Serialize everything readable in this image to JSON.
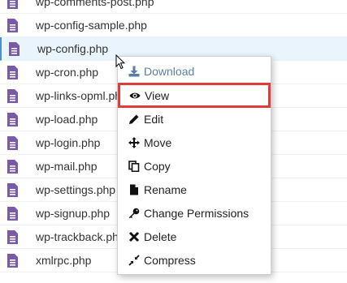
{
  "files": [
    {
      "name": "wp-comments-post.php"
    },
    {
      "name": "wp-config-sample.php"
    },
    {
      "name": "wp-config.php",
      "selected": true
    },
    {
      "name": "wp-cron.php"
    },
    {
      "name": "wp-links-opml.php"
    },
    {
      "name": "wp-load.php"
    },
    {
      "name": "wp-login.php"
    },
    {
      "name": "wp-mail.php"
    },
    {
      "name": "wp-settings.php"
    },
    {
      "name": "wp-signup.php"
    },
    {
      "name": "wp-trackback.php"
    },
    {
      "name": "xmlrpc.php"
    }
  ],
  "context_menu": {
    "items": [
      {
        "label": "Download",
        "icon": "download-icon"
      },
      {
        "label": "View",
        "icon": "eye-icon"
      },
      {
        "label": "Edit",
        "icon": "pencil-icon"
      },
      {
        "label": "Move",
        "icon": "move-arrows-icon"
      },
      {
        "label": "Copy",
        "icon": "copy-icon"
      },
      {
        "label": "Rename",
        "icon": "file-icon"
      },
      {
        "label": "Change Permissions",
        "icon": "key-icon"
      },
      {
        "label": "Delete",
        "icon": "x-icon"
      },
      {
        "label": "Compress",
        "icon": "compress-icon"
      }
    ]
  },
  "colors": {
    "file_icon": "#7a5aa8",
    "selected_row": "#eaf4fd",
    "highlight_outline": "#e23b3b",
    "download_text": "#5a7fa6"
  }
}
